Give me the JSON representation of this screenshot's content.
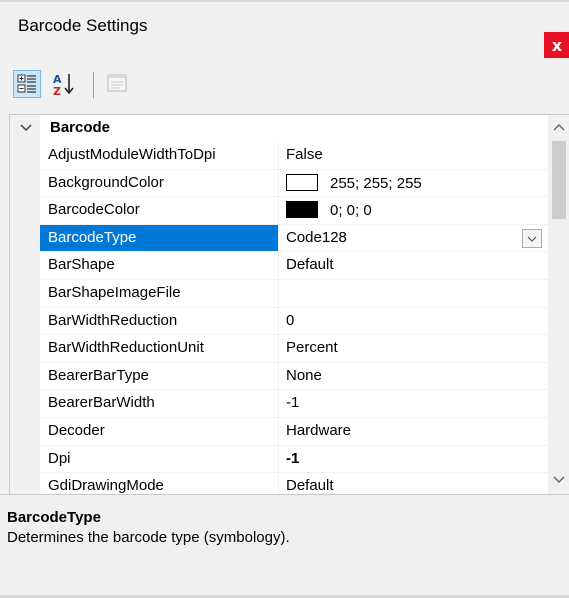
{
  "window": {
    "title": "Barcode Settings",
    "close_glyph": "x"
  },
  "toolbar": {
    "categorized_icon": "categorized-icon",
    "alphabetical_icon": "alphabetical-sort-icon",
    "property_pages_icon": "property-pages-icon"
  },
  "category": {
    "label": "Barcode",
    "state": "expanded"
  },
  "properties": [
    {
      "name": "AdjustModuleWidthToDpi",
      "value": "False"
    },
    {
      "name": "BackgroundColor",
      "value": "255; 255; 255",
      "swatch": "#ffffff"
    },
    {
      "name": "BarcodeColor",
      "value": "0; 0; 0",
      "swatch": "#000000"
    },
    {
      "name": "BarcodeType",
      "value": "Code128",
      "selected": true
    },
    {
      "name": "BarShape",
      "value": "Default"
    },
    {
      "name": "BarShapeImageFile",
      "value": ""
    },
    {
      "name": "BarWidthReduction",
      "value": "0"
    },
    {
      "name": "BarWidthReductionUnit",
      "value": "Percent"
    },
    {
      "name": "BearerBarType",
      "value": "None"
    },
    {
      "name": "BearerBarWidth",
      "value": "-1"
    },
    {
      "name": "Decoder",
      "value": "Hardware"
    },
    {
      "name": "Dpi",
      "value": "-1",
      "bold": true
    },
    {
      "name": "GdiDrawingMode",
      "value": "Default"
    }
  ],
  "description": {
    "title": "BarcodeType",
    "text": "Determines the barcode type (symbology)."
  },
  "colors": {
    "selection": "#0078d7",
    "close": "#e81123"
  }
}
